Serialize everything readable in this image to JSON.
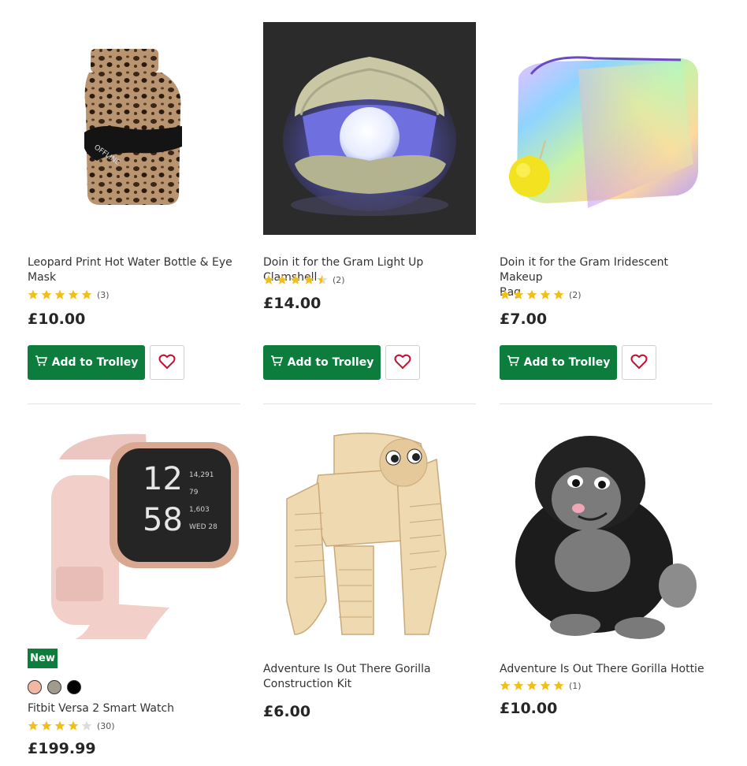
{
  "buttons": {
    "add_to_trolley": "Add to Trolley"
  },
  "colors": {
    "primary_green": "#0c7d3d",
    "star_gold": "#f2bf1a",
    "heart_red": "#c8102e"
  },
  "products": [
    {
      "title_line1": "Leopard Print Hot Water Bottle & Eye",
      "title_line2": "Mask",
      "rating": 5,
      "reviews": "(3)",
      "price": "£10.00",
      "image": "leopard-hot-water-bottle"
    },
    {
      "title_line1": "Doin it for the Gram Light Up Clamshell",
      "title_line2": "",
      "rating": 4.5,
      "reviews": "(2)",
      "price": "£14.00",
      "image": "clamshell-light"
    },
    {
      "title_line1": "Doin it for the Gram Iridescent Makeup",
      "title_line2": "Bag",
      "rating": 5,
      "reviews": "(2)",
      "price": "£7.00",
      "image": "iridescent-makeup-bag"
    },
    {
      "title_line1": "Fitbit Versa 2 Smart Watch",
      "title_line2": "",
      "rating": 4,
      "reviews": "(30)",
      "price": "£199.99",
      "badge": "New",
      "image": "fitbit-versa-2",
      "watch_face": {
        "time_h": "12",
        "time_m": "58",
        "steps": "14,291",
        "heart": "79",
        "cal": "1,603",
        "date": "WED 28"
      },
      "swatches": [
        "#f1b9a5",
        "#a09a8f",
        "#000000"
      ]
    },
    {
      "title_line1": "Adventure Is Out There Gorilla",
      "title_line2": "Construction Kit",
      "rating": 0,
      "reviews": "",
      "price": "£6.00",
      "image": "wooden-gorilla-kit"
    },
    {
      "title_line1": "Adventure Is Out There Gorilla Hottie",
      "title_line2": "",
      "rating": 5,
      "reviews": "(1)",
      "price": "£10.00",
      "image": "plush-gorilla"
    }
  ]
}
